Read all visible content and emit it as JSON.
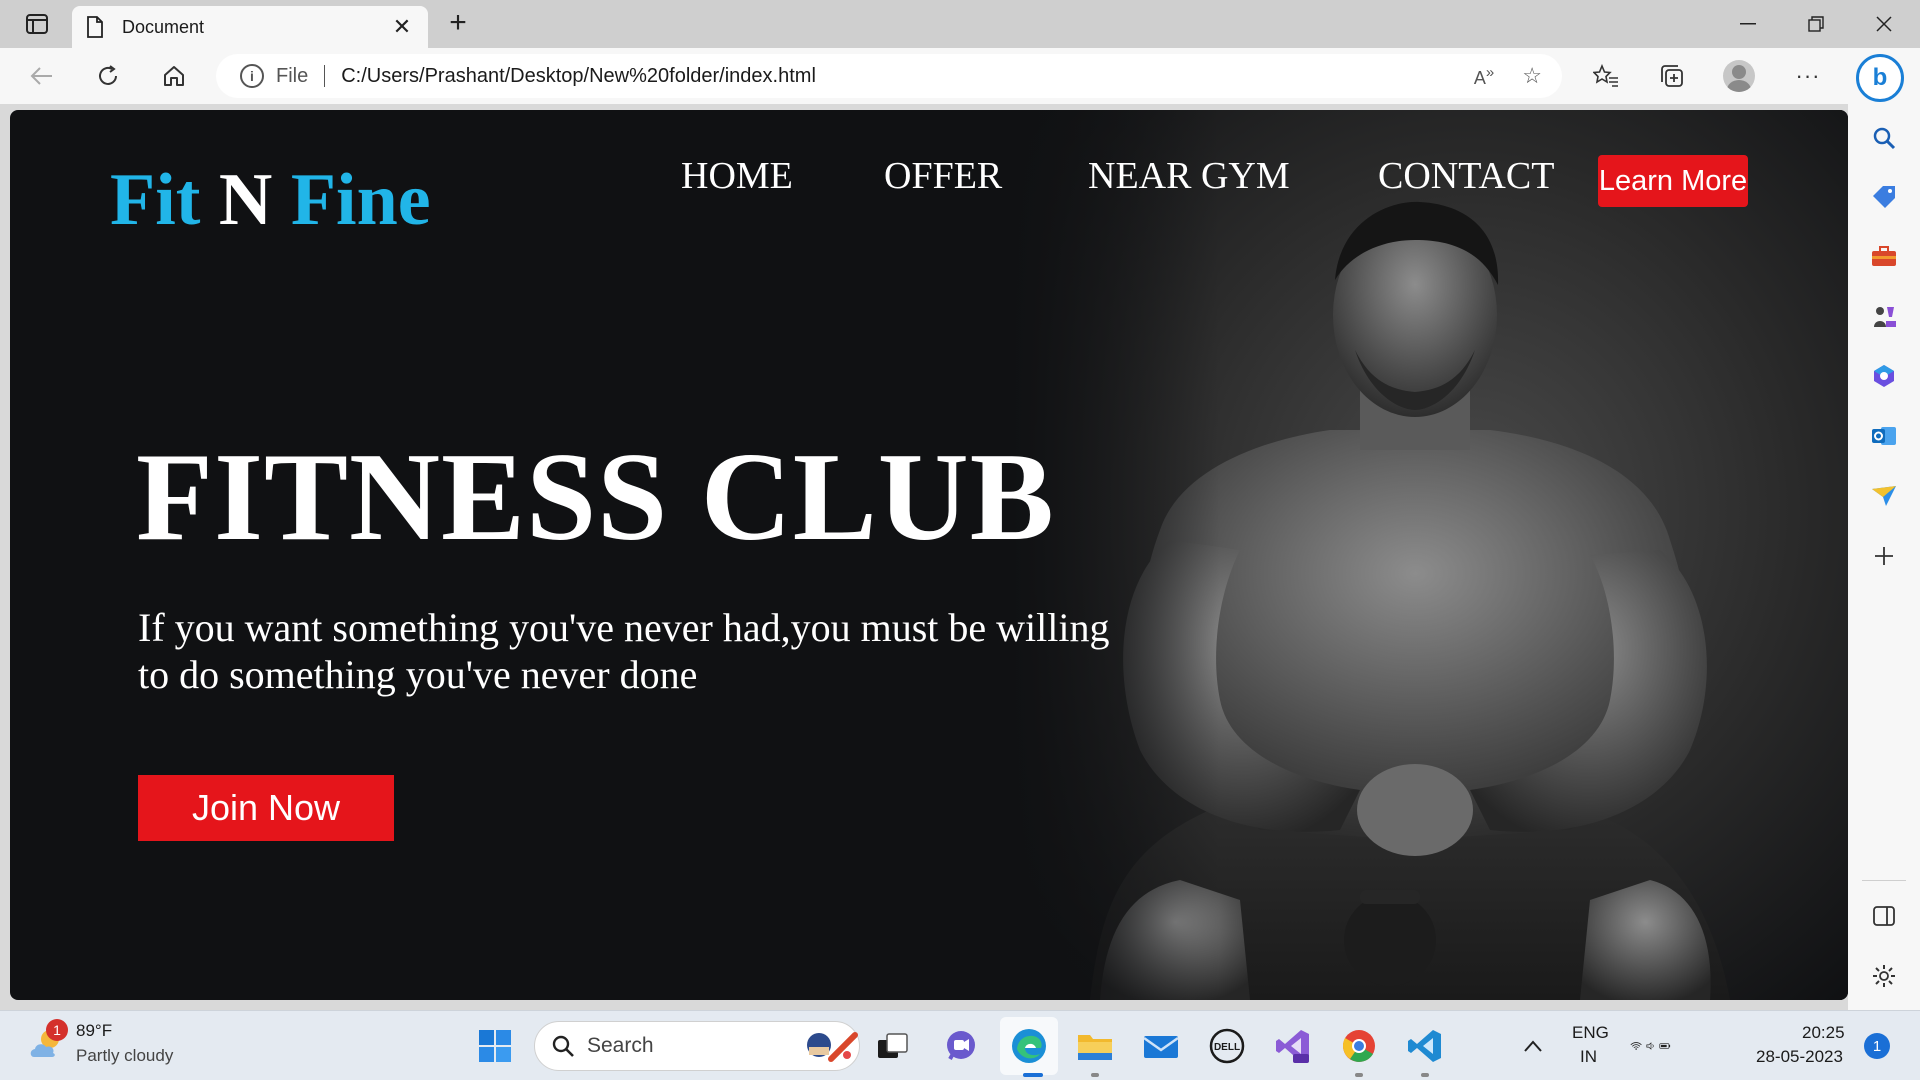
{
  "browser": {
    "tab_title": "Document",
    "address_scheme": "File",
    "url": "C:/Users/Prashant/Desktop/New%20folder/index.html"
  },
  "page": {
    "logo": {
      "part1": "Fit",
      "part2": "N",
      "part3": "Fine"
    },
    "nav": [
      "HOME",
      "OFFER",
      "NEAR GYM",
      "CONTACT"
    ],
    "learn_more": "Learn More",
    "headline": "FITNESS CLUB",
    "tagline_line1": "If you want something you've never had,you must be willing",
    "tagline_line2": "to do something you've never done",
    "join_now": "Join Now",
    "colors": {
      "accent_blue": "#21b5e8",
      "button_red": "#e5151b",
      "background": "#101113"
    }
  },
  "taskbar": {
    "weather_temp": "89°F",
    "weather_desc": "Partly cloudy",
    "weather_badge": "1",
    "search_placeholder": "Search",
    "lang_1": "ENG",
    "lang_2": "IN",
    "time": "20:25",
    "date": "28-05-2023",
    "notification_count": "1"
  }
}
